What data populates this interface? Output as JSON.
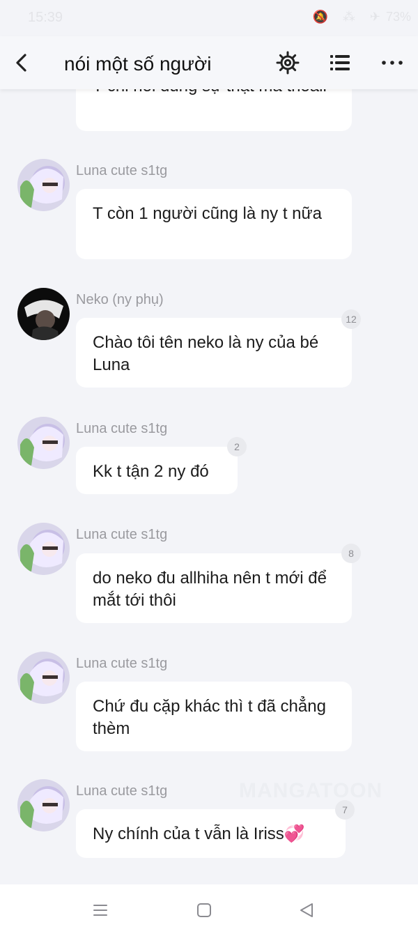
{
  "status_bar": {
    "time": "15:39",
    "icons": "🔕 ⁂ ✈",
    "battery": "73%"
  },
  "header": {
    "title": "nói một số người",
    "back_icon": "chevron-left-icon",
    "settings_icon": "gear-icon",
    "list_icon": "list-icon",
    "more_icon": "more-horizontal-icon"
  },
  "messages": [
    {
      "sender": "",
      "text": "T chỉ nói đúng sự thật mà thoaii",
      "badge": ""
    },
    {
      "sender": "Luna cute s1tg",
      "text": "T còn 1 người cũng là ny t nữa",
      "badge": ""
    },
    {
      "sender": "Neko (ny phụ)",
      "text": "Chào tôi tên neko là ny của bé Luna",
      "badge": "12"
    },
    {
      "sender": "Luna cute s1tg",
      "text": "Kk t tận 2 ny đó",
      "badge": "2"
    },
    {
      "sender": "Luna cute s1tg",
      "text": "do neko đu allhiha nên t mới để mắt tới thôi",
      "badge": "8"
    },
    {
      "sender": "Luna cute s1tg",
      "text": "Chứ đu cặp khác thì t đã chẳng thèm",
      "badge": ""
    },
    {
      "sender": "Luna cute s1tg",
      "text": "Ny chính của t vẫn là Iriss💞",
      "badge": "7"
    }
  ],
  "watermark": "MANGATOON",
  "nav": {
    "menu_icon": "menu-icon",
    "home_icon": "square-icon",
    "back_icon": "triangle-back-icon"
  },
  "colors": {
    "background": "#f3f4f8",
    "bubble": "#ffffff",
    "sender": "#9a9a9f",
    "badge": "#e9eaee"
  }
}
